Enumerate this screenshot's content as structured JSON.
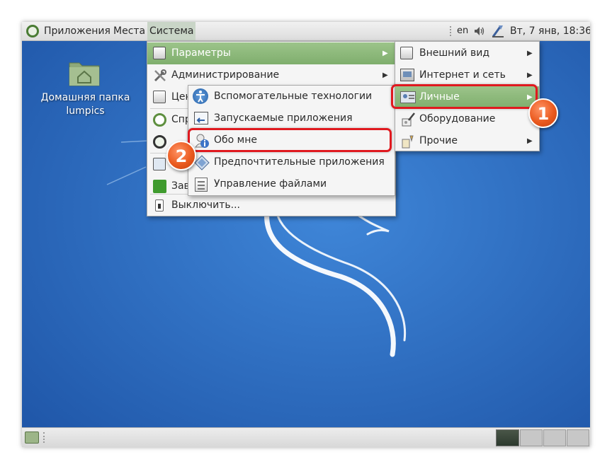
{
  "top_panel": {
    "applications": "Приложения",
    "places": "Места",
    "system": "Система",
    "keyboard_layout": "en",
    "clock": "Вт, 7 янв, 18:36"
  },
  "desktop": {
    "home_folder_label_line1": "Домашняя папка",
    "home_folder_label_line2": "lumpics"
  },
  "system_menu": {
    "items": [
      {
        "label": "Параметры",
        "icon": "preferences-icon",
        "submenu": true
      },
      {
        "label": "Администрирование",
        "icon": "admin-tools-icon",
        "submenu": true
      },
      {
        "label": "Цен",
        "icon": "control-center-icon"
      },
      {
        "label": "Спр",
        "icon": "help-icon"
      },
      {
        "label": "",
        "icon": "about-debian-icon"
      },
      {
        "label": "",
        "icon": "lock-screen-icon"
      },
      {
        "label": "Зав",
        "icon": "logout-icon"
      },
      {
        "label": "Выключить...",
        "icon": "shutdown-icon"
      }
    ]
  },
  "preferences_submenu": {
    "items": [
      {
        "label": "Внешний вид",
        "icon": "appearance-icon"
      },
      {
        "label": "Интернет и сеть",
        "icon": "network-icon"
      },
      {
        "label": "Личные",
        "icon": "personal-icon"
      },
      {
        "label": "Оборудование",
        "icon": "hardware-icon"
      },
      {
        "label": "Прочие",
        "icon": "other-icon"
      }
    ]
  },
  "personal_submenu": {
    "items": [
      {
        "label": "Вспомогательные технологии",
        "icon": "accessibility-icon"
      },
      {
        "label": "Запускаемые приложения",
        "icon": "startup-apps-icon"
      },
      {
        "label": "Обо мне",
        "icon": "about-me-icon"
      },
      {
        "label": "Предпочтительные приложения",
        "icon": "preferred-apps-icon"
      },
      {
        "label": "Управление файлами",
        "icon": "file-management-icon"
      }
    ]
  },
  "callouts": {
    "step1": "1",
    "step2": "2"
  },
  "colors": {
    "desktop_blue": "#2e6ec2",
    "menu_highlight": "#8ab878",
    "callout_red": "#e0191f",
    "badge_orange": "#ea5a1f"
  }
}
